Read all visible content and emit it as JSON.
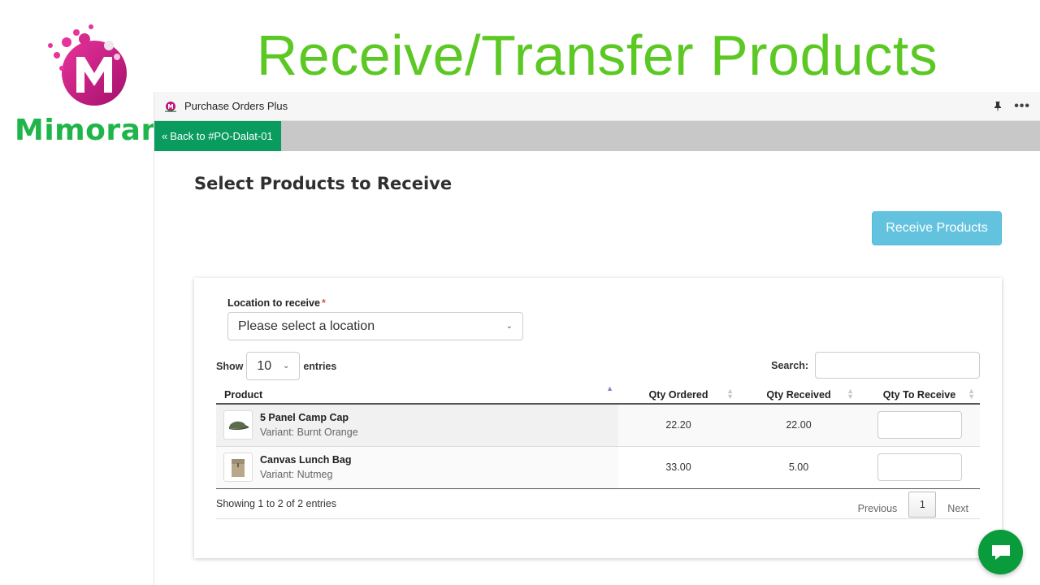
{
  "brand": {
    "name": "Mimoran",
    "color": "#1fb54a",
    "mark_color": "#c0157a"
  },
  "headline": "Receive/Transfer Products",
  "app": {
    "title": "Purchase Orders Plus",
    "header_icons": [
      "pin-icon",
      "more-icon"
    ],
    "more_symbol": "•••"
  },
  "nav": {
    "back_label": "Back to #PO-Dalat-01",
    "back_color": "#0a9c5e"
  },
  "page": {
    "title": "Select Products to Receive",
    "receive_button": "Receive Products"
  },
  "form": {
    "location_label": "Location to receive",
    "required_mark": "*",
    "location_value": "Please select a location"
  },
  "table_controls": {
    "show_label": "Show",
    "entries_value": "10",
    "entries_label": "entries",
    "search_label": "Search:"
  },
  "table": {
    "columns": [
      "Product",
      "Qty Ordered",
      "Qty Received",
      "Qty To Receive"
    ],
    "rows": [
      {
        "name": "5 Panel Camp Cap",
        "variant": "Variant: Burnt Orange",
        "qty_ordered": "22.20",
        "qty_received": "22.00",
        "qty_to_receive": "",
        "thumb_icon": "cap-icon"
      },
      {
        "name": "Canvas Lunch Bag",
        "variant": "Variant: Nutmeg",
        "qty_ordered": "33.00",
        "qty_received": "5.00",
        "qty_to_receive": "",
        "thumb_icon": "bag-icon"
      }
    ]
  },
  "footer": {
    "info": "Showing 1 to 2 of 2 entries",
    "previous": "Previous",
    "current_page": "1",
    "next": "Next"
  },
  "colors": {
    "headline": "#5bc823",
    "receive_button": "#5bc0de",
    "chat": "#0a9c3c"
  }
}
